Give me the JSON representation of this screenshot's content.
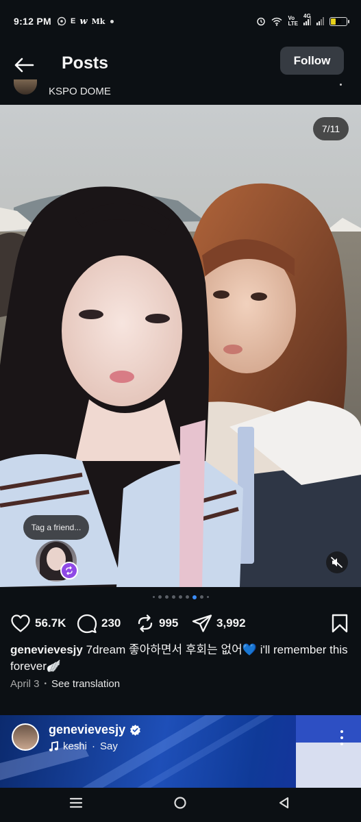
{
  "status_bar": {
    "time": "9:12 PM",
    "notif_icons": [
      "whatsapp-icon",
      "e-icon",
      "w-icon",
      "mk-icon",
      "dot-icon"
    ],
    "e_glyph": "E",
    "w_glyph": "w",
    "mk_glyph": "Mk",
    "network_label_top": "Vo",
    "network_label_bottom": "LTE",
    "network_type": "4G",
    "battery_level": "30"
  },
  "header": {
    "title": "Posts",
    "follow_label": "Follow",
    "location": "KSPO DOME"
  },
  "post": {
    "image_counter": "7/11",
    "carousel": {
      "total_dots": 9,
      "active_index": 6
    },
    "tag_prompt": "Tag a friend...",
    "likes": "56.7K",
    "comments": "230",
    "reposts": "995",
    "shares": "3,992",
    "caption_user": "genevievesjy",
    "caption_text": "7dream 좋아하면서 후회는 없어💙 i'll remember this forever🪽",
    "date": "April 3",
    "see_translation": "See translation"
  },
  "next_post": {
    "username": "genevievesjy",
    "music_artist": "keshi",
    "music_song": "Say"
  },
  "colors": {
    "background": "#0c1014",
    "follow_bg": "#363b42",
    "accent_blue": "#3b8cf6",
    "tag_badge": "#8f49e6"
  }
}
